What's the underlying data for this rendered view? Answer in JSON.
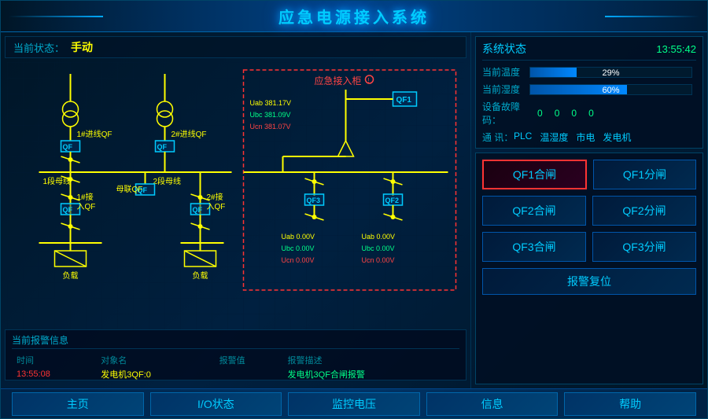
{
  "header": {
    "title": "应急电源接入系统"
  },
  "status_bar": {
    "label": "当前状态：",
    "value": "手动"
  },
  "system_status": {
    "title": "系统状态",
    "time": "13:55:42",
    "temp_label": "当前温度",
    "temp_value": "29%",
    "temp_percent": 29,
    "humidity_label": "当前湿度",
    "humidity_value": "60%",
    "humidity_percent": 60,
    "fault_label": "设备故障码：",
    "fault_values": [
      "0",
      "0",
      "0",
      "0"
    ],
    "comm_label": "通  讯：",
    "comm_items": [
      "PLC",
      "温湿度",
      "市电",
      "发电机"
    ]
  },
  "control_buttons": {
    "qf1_close": "QF1合闸",
    "qf1_open": "QF1分闸",
    "qf2_close": "QF2合闸",
    "qf2_open": "QF2分闸",
    "qf3_close": "QF3合闸",
    "qf3_open": "QF3分闸",
    "alarm_reset": "报警复位"
  },
  "alarm_section": {
    "title": "当前报警信息",
    "columns": [
      "时间",
      "对象名",
      "报警值",
      "报警描述"
    ],
    "rows": [
      {
        "time": "13:55:08",
        "device": "发电机3QF:0",
        "value": "",
        "desc": "发电机3QF合闸报警"
      }
    ]
  },
  "footer": {
    "buttons": [
      "主页",
      "I/O状态",
      "监控电压",
      "信息",
      "帮助"
    ]
  },
  "diagram": {
    "emergency_label": "应急接入柜",
    "feeder1_label": "1#进线QF",
    "feeder2_label": "2#进线QF",
    "bus1_label": "1段母线",
    "bus2_label": "2段母线",
    "tie_label": "母联QF",
    "load1_label": "负载",
    "load2_label": "负载",
    "incoming1_label": "1#接\n入QF",
    "incoming2_label": "2#接\n入QF",
    "qf1_label": "QF1",
    "qf2_label": "QF2",
    "qf3_label": "QF3",
    "uab1": "Uab  381.17V",
    "ubc1": "Ubc  381.09V",
    "ucn1": "Ucn  381.07V",
    "uab2": "Uab  0.00V",
    "ubc2": "Ubc  0.00V",
    "ucn2": "Ucn  0.00V",
    "uab3": "Uab  0.00V",
    "ubc3": "Ubc  0.00V",
    "ucn3": "Ucn  0.00V"
  }
}
